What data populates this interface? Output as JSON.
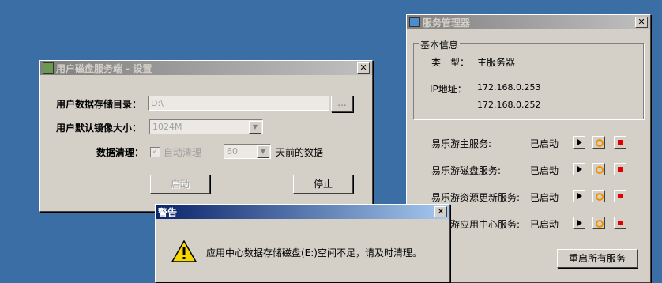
{
  "settings": {
    "title": "用户磁盘服务端 - 设置",
    "storage_label": "用户数据存储目录：",
    "storage_value": "D:\\",
    "browse_label": "...",
    "image_size_label": "用户默认镜像大小：",
    "image_size_value": "1024M",
    "cleanup_label": "数据清理：",
    "auto_clean_label": "自动清理",
    "days_value": "60",
    "days_suffix": "天前的数据",
    "start_label": "启动",
    "stop_label": "停止"
  },
  "service_manager": {
    "title": "服务管理器",
    "group_label": "基本信息",
    "type_label": "类　型：",
    "type_value": "主服务器",
    "ip_label": "IP地址：",
    "ip_values": [
      "172.168.0.253",
      "172.168.0.252"
    ],
    "services": [
      {
        "name": "易乐游主服务:",
        "status": "已启动"
      },
      {
        "name": "易乐游磁盘服务:",
        "status": "已启动"
      },
      {
        "name": "易乐游资源更新服务:",
        "status": "已启动"
      },
      {
        "name": "易乐游应用中心服务:",
        "status": "已启动"
      }
    ],
    "restart_all_label": "重启所有服务"
  },
  "warning": {
    "title": "警告",
    "message": "应用中心数据存储磁盘(E:)空间不足，请及时清理。"
  },
  "colors": {
    "desktop": "#3a6ea5",
    "active_title": "#0a246a",
    "stop_red": "#e00000",
    "restart_orange": "#f09000"
  }
}
